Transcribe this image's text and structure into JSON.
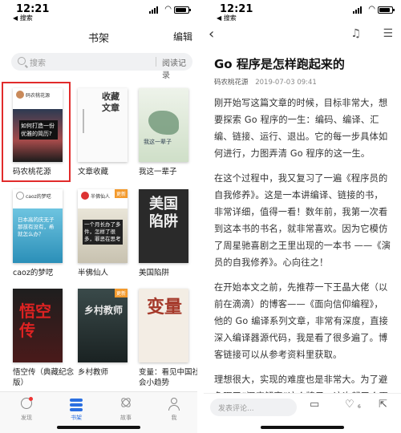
{
  "status": {
    "time": "12:21",
    "back_app": "◀ 搜索"
  },
  "bookshelf": {
    "title": "书架",
    "edit_label": "编辑",
    "search_placeholder": "搜索",
    "history_label": "阅读记录",
    "books": [
      {
        "name": "码农桃花源",
        "cover_top": "码农桃花源",
        "cover_text": "如何打造一份优雅的简历?"
      },
      {
        "name": "文章收藏",
        "cover_text": "收藏文章"
      },
      {
        "name": "我这一辈子",
        "cover_text": "我这一辈子"
      },
      {
        "name": "caoz的梦呓",
        "cover_top": "caoz的梦呓",
        "cover_text": "日本高的庆无子那孩有没有，希就怎么办？"
      },
      {
        "name": "半佛仙人",
        "cover_top": "半佛仙人",
        "cover_text": "一个月长办了多件，怎样了很多，罪恶在思考",
        "tag": "更新"
      },
      {
        "name": "美国陷阱",
        "cover_text": "美国陷阱"
      },
      {
        "name": "悟空传（典藏纪念版）",
        "cover_text": "悟空传"
      },
      {
        "name": "乡村教师",
        "cover_text": "乡村教师",
        "tag": "更新"
      },
      {
        "name": "变量：看见中国社会小趋势",
        "cover_text": "变量"
      }
    ]
  },
  "tabs": [
    {
      "label": "发现",
      "icon": "compass-icon"
    },
    {
      "label": "书架",
      "icon": "bookshelf-icon"
    },
    {
      "label": "故事",
      "icon": "story-icon"
    },
    {
      "label": "我",
      "icon": "profile-icon"
    }
  ],
  "article": {
    "title": "Go 程序是怎样跑起来的",
    "author": "码农桃花源",
    "date": "2019-07-03 09:41",
    "paragraphs": [
      "刚开始写这篇文章的时候，目标非常大，想要探索 Go 程序的一生：编码、编译、汇编、链接、运行、退出。它的每一步具体如何进行，力图弄清 Go 程序的这一生。",
      "在这个过程中，我又复习了一遍《程序员的自我修养》。这是一本讲编译、链接的书，非常详细，值得一看！数年前，我第一次看到这本书的书名，就非常喜欢。因为它模仿了周星驰喜剧之王里出现的一本书 ——《演员的自我修养》。心向往之！",
      "在开始本文之前，先推荐一下王晶大佬（以前在滴滴）的博客——《面向信仰编程》，他的 Go 编译系列文章，非常有深度，直接深入编译器源代码，我是看了很多遍了。博客链接可以从参考资料里获取。",
      "理想很大，实现的难度也是非常大。为了避免砸了“深度解密”这个牌子，这次起了个更"
    ],
    "comment_placeholder": "发表评论...",
    "likes": "6"
  },
  "colors": {
    "accent": "#2b6fe0",
    "selection": "#e12b2b",
    "tag": "#f39a2d"
  }
}
